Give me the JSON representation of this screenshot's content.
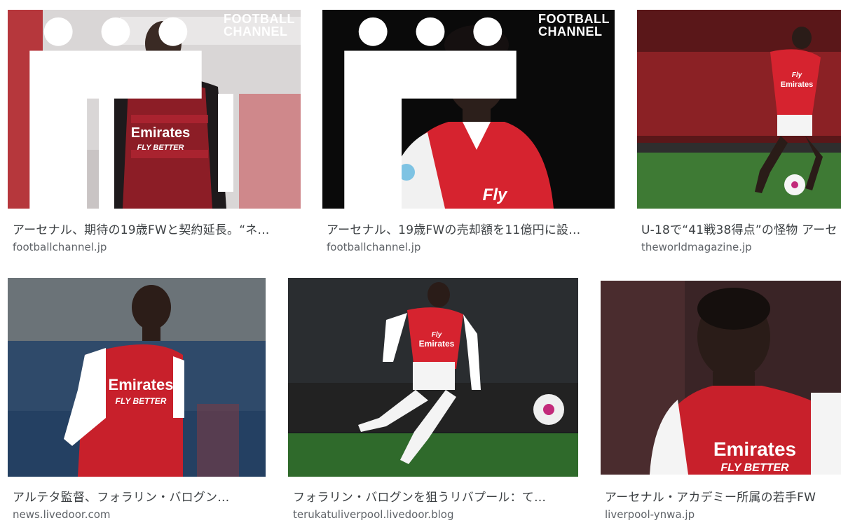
{
  "results": [
    {
      "title": "アーセナル、期待の19歳FWと契約延長。“ネ…",
      "source": "footballchannel.jp",
      "watermark": [
        "FOOTBALL",
        "CHANNEL"
      ],
      "jersey": [
        "Emirates",
        "FLY BETTER"
      ]
    },
    {
      "title": "アーセナル、19歳FWの売却額を11億円に設…",
      "source": "footballchannel.jp",
      "watermark": [
        "FOOTBALL",
        "CHANNEL"
      ],
      "jersey": [
        "Fly"
      ]
    },
    {
      "title": "U-18で“41戦38得点”の怪物 アーセ",
      "source": "theworldmagazine.jp",
      "jersey": [
        "Fly",
        "Emirates"
      ]
    },
    {
      "title": "アルテタ監督、フォラリン・バログン…",
      "source": "news.livedoor.com",
      "jersey": [
        "Emirates",
        "FLY BETTER"
      ]
    },
    {
      "title": "フォラリン・バログンを狙うリバプール：て…",
      "source": "terukatuliverpool.livedoor.blog",
      "jersey": [
        "Fly",
        "Emirates"
      ]
    },
    {
      "title": "アーセナル・アカデミー所属の若手FW",
      "source": "liverpool-ynwa.jp",
      "jersey": [
        "Emirates",
        "FLY BETTER"
      ]
    }
  ],
  "colors": {
    "arsenal_red": "#d4202c",
    "title_text": "#3c4043",
    "source_text": "#5f6368",
    "pitch_green": "#3e7a34"
  }
}
